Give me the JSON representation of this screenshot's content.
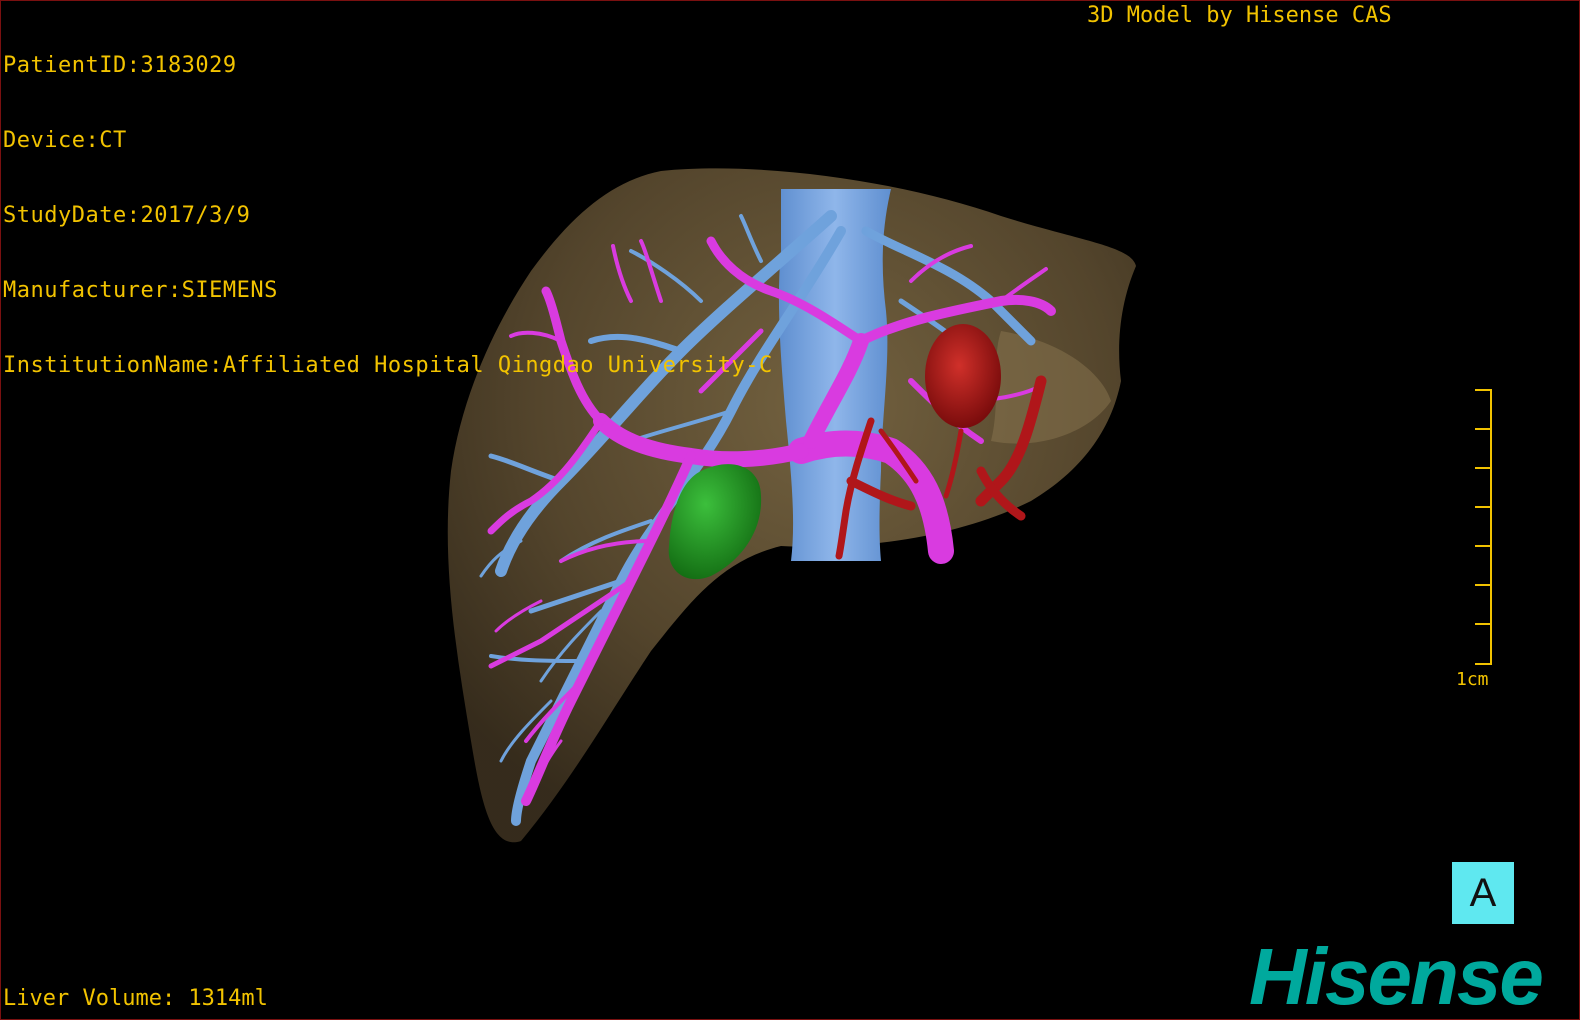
{
  "header": {
    "patient_id": "PatientID:3183029",
    "device": "Device:CT",
    "study_date": "StudyDate:2017/3/9",
    "manufacturer": "Manufacturer:SIEMENS",
    "institution": "InstitutionName:Affiliated Hospital Qingdao University-C"
  },
  "credit": "3D Model by Hisense CAS",
  "scale": {
    "label": "1cm"
  },
  "view_orientation": "A",
  "footer": {
    "volume": "Liver Volume: 1314ml"
  },
  "brand": {
    "logo_text": "Hisense",
    "color": "#00a99d"
  },
  "colors": {
    "text": "#f2c300",
    "liver": "#6a5838",
    "portal_vein": "#d93be0",
    "hepatic_vein": "#6fa2dc",
    "ivc": "#7ea8e0",
    "artery_lesion": "#b0161a",
    "gallbladder": "#1f8a1f"
  }
}
